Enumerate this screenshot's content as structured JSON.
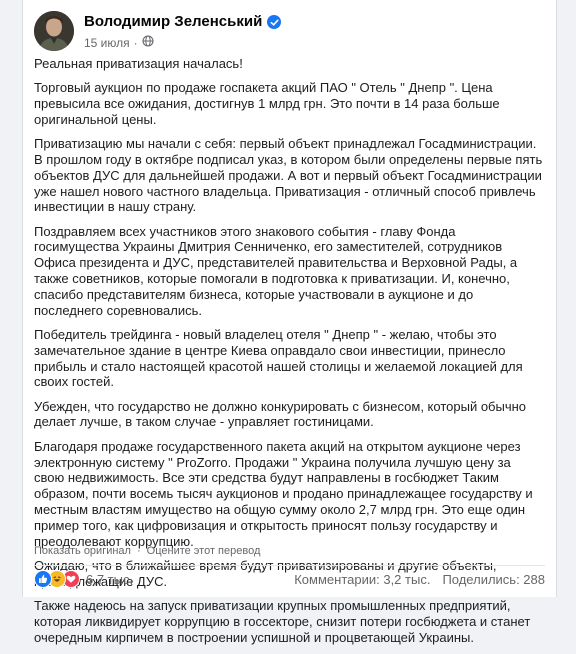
{
  "post": {
    "author": "Володимир Зеленський",
    "date": "15 июля",
    "paragraphs": [
      "Реальная приватизация началась!",
      "Торговый аукцион по продаже госпакета акций ПАО \" Отель \" Днепр \". Цена превысила все ожидания, достигнув 1 млрд грн. Это почти в 14 раза больше оригинальной цены.",
      "Приватизацию мы начали с себя: первый объект принадлежал Госадминистрации. В прошлом году в октябре подписал указ, в котором были определены первые пять объектов ДУС для дальнейшей продажи. А вот и первый объект Госадминистрации уже нашел нового частного владельца. Приватизация - отличный способ привлечь инвестиции в нашу страну.",
      "Поздравляем всех участников этого знакового события - главу Фонда госимущества Украины Дмитрия Сенниченко, его заместителей, сотрудников Офиса президента и ДУС, представителей правительства и Верховной Рады, а также советников, которые помогали в подготовка к приватизации. И, конечно, спасибо представителям бизнеса, которые участвовали в аукционе и до последнего соревновались.",
      "Победитель трейдинга - новый владелец отеля \" Днепр \" - желаю, чтобы это замечательное здание в центре Киева оправдало свои инвестиции, принесло прибыль и стало настоящей красотой нашей столицы и желаемой локацией для своих гостей.",
      "Убежден, что государство не должно конкурировать с бизнесом, который обычно делает лучше, в таком случае - управляет гостиницами.",
      "Благодаря продаже государственного пакета акций на открытом аукционе через электронную систему \" ProZorro. Продажи \" Украина получила лучшую цену за свою недвижимость. Все эти средства будут направлены в госбюджет Таким образом, почти восемь тысяч аукционов и продано принадлежащее государству и местным властям имущество на общую сумму около 2,7 млрд грн. Это еще один пример того, как цифровизация и открытость приносят пользу государству и преодолевают коррупцию.",
      "Ожидаю, что в ближайшее время будут приватизированы и другие объекты, принадлежащие ДУС.",
      "Также надеюсь на запуск приватизации крупных промышленных предприятий, которая ликвидирует коррупцию в госсекторе, снизит потери госбюджета и станет очередным кирпичем в построении успишной и процветающей Украины."
    ],
    "translation": {
      "show_original": "Показать оригинал",
      "separator": "·",
      "rate_translation": "Оцените этот перевод"
    },
    "reactions_count": "6,7 тыс.",
    "comments": "Комментарии: 3,2 тыс.",
    "shares": "Поделились: 288"
  },
  "colors": {
    "accent": "#1877f2",
    "text": "#1c1e21",
    "secondary": "#65676b"
  }
}
